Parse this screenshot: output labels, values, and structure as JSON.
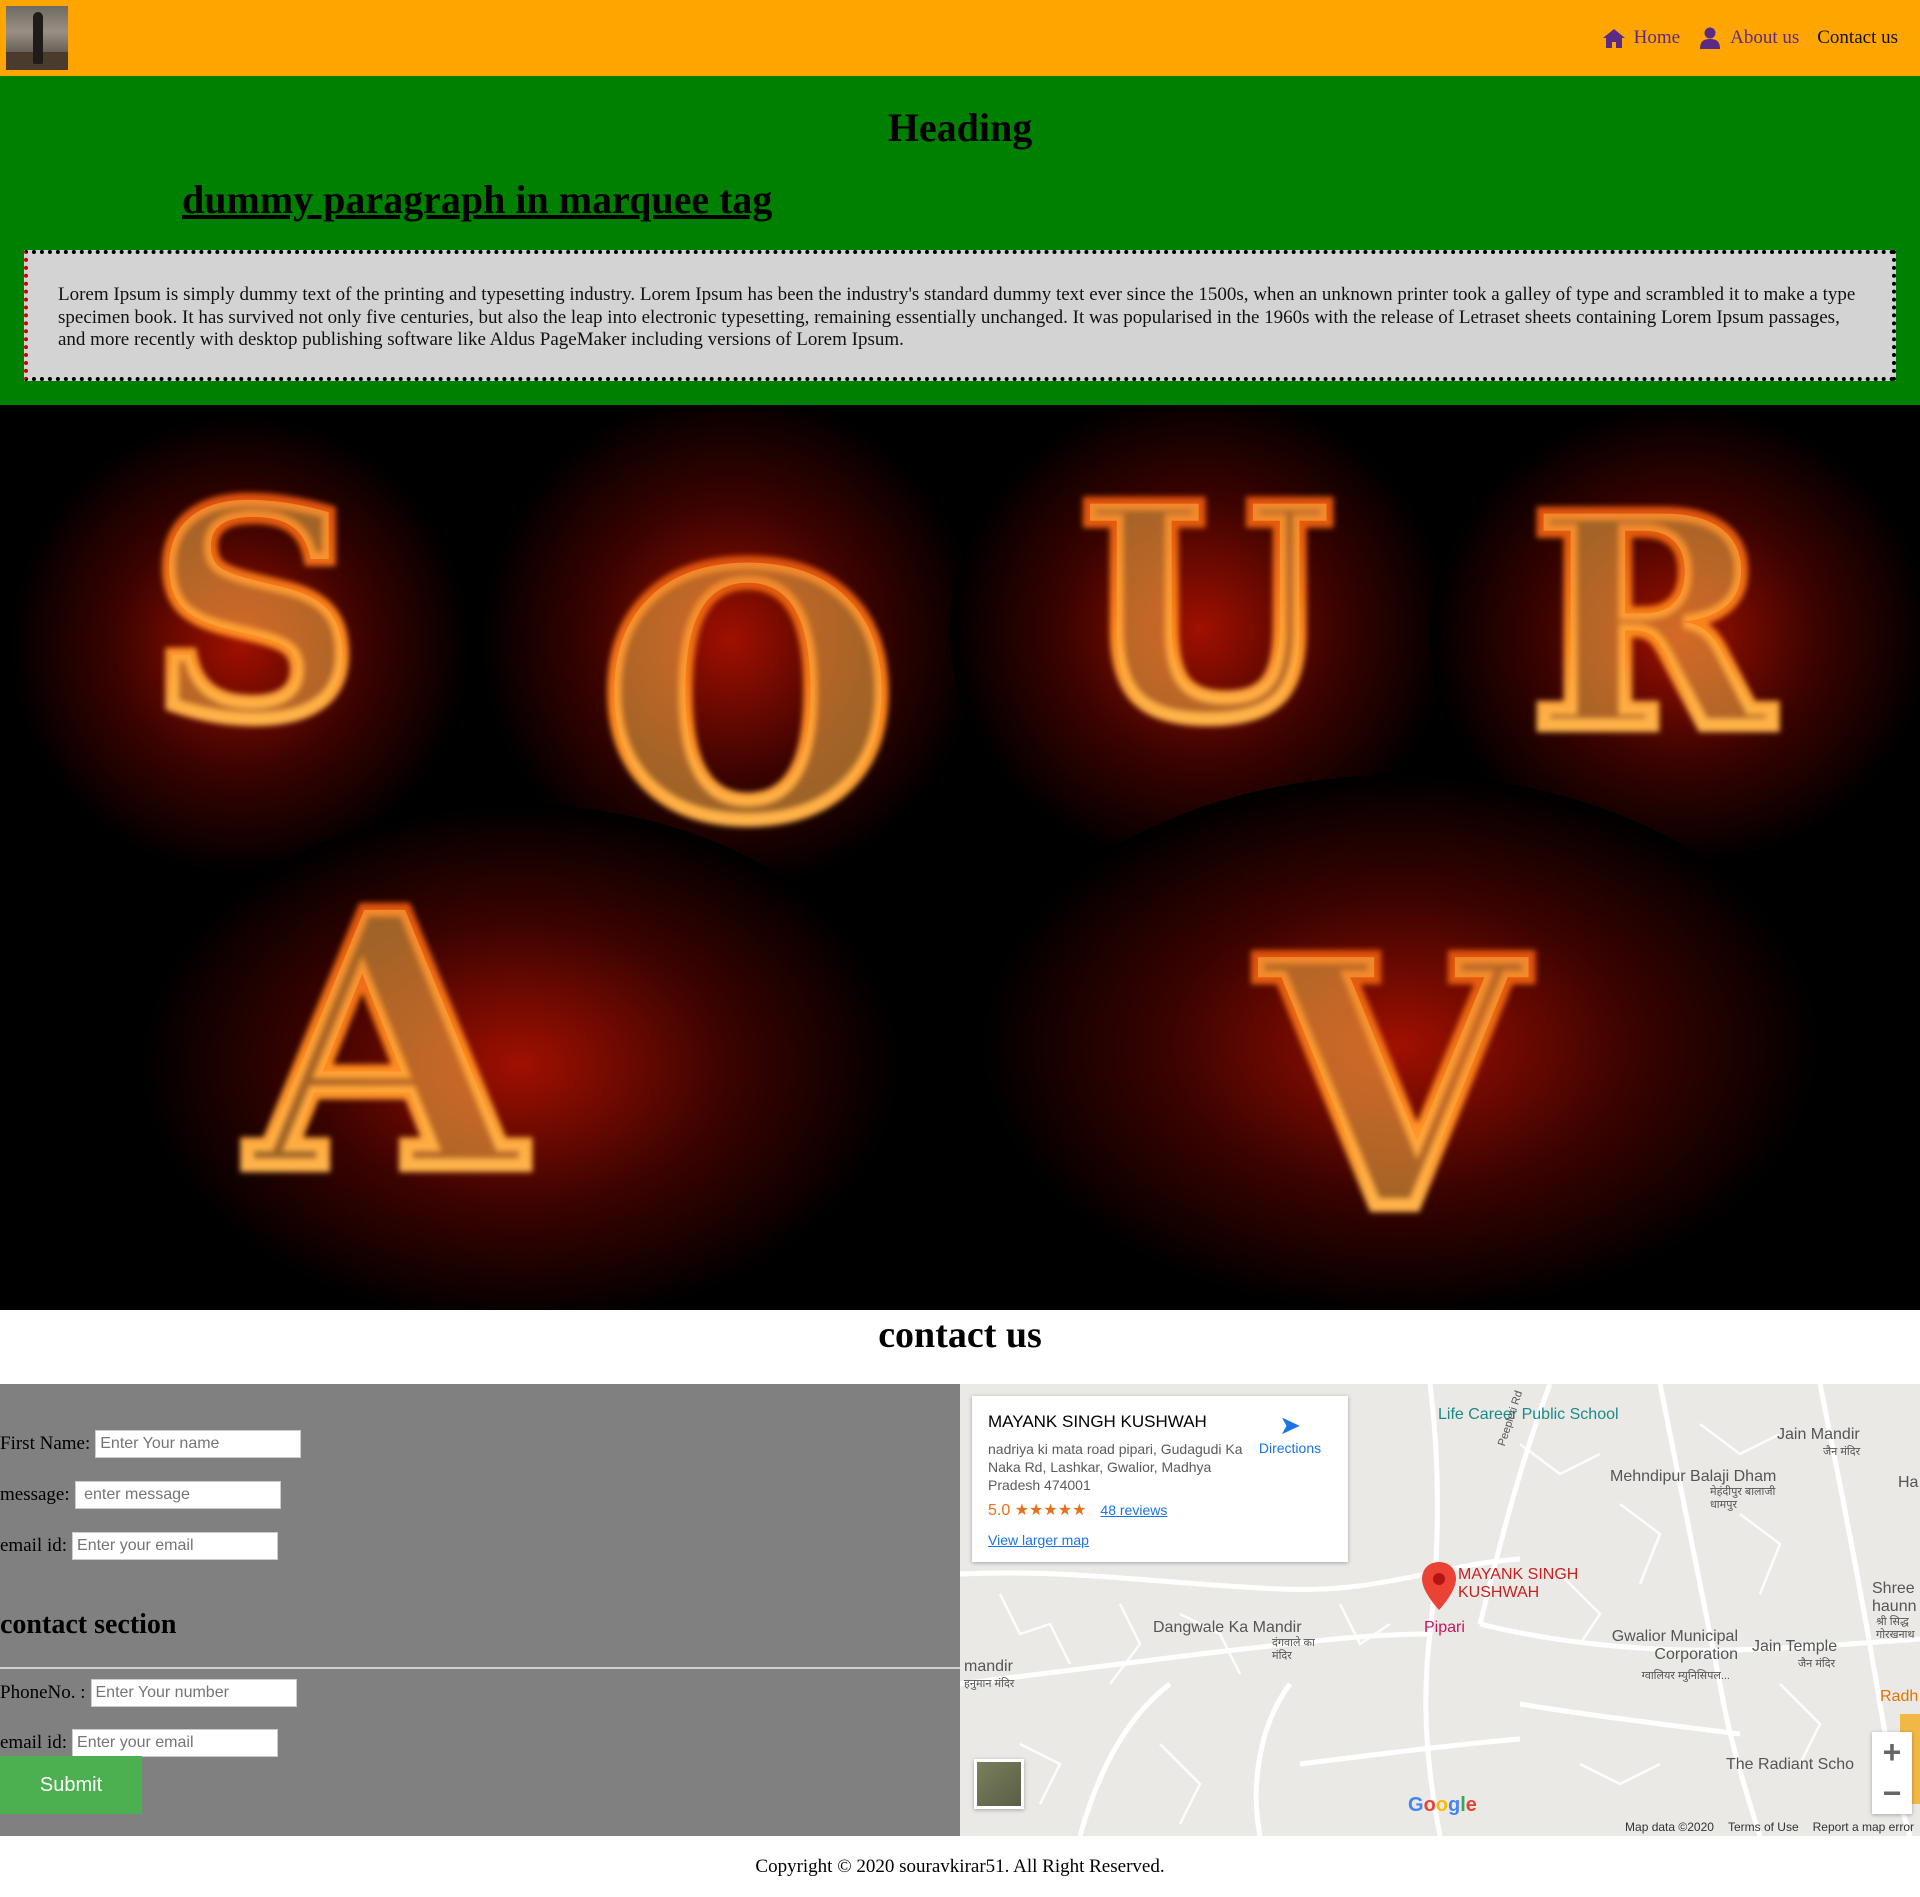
{
  "header": {
    "nav": [
      {
        "label": "Home",
        "icon": "home-icon"
      },
      {
        "label": "About us",
        "icon": "user-icon"
      },
      {
        "label": "Contact us"
      }
    ]
  },
  "hero": {
    "heading": "Heading",
    "marquee_text": "dummy paragraph in marquee tag",
    "lorem": "Lorem Ipsum is simply dummy text of the printing and typesetting industry. Lorem Ipsum has been the industry's standard dummy text ever since the 1500s, when an unknown printer took a galley of type and scrambled it to make a type specimen book. It has survived not only five centuries, but also the leap into electronic typesetting, remaining essentially unchanged. It was popularised in the 1960s with the release of Letraset sheets containing Lorem Ipsum passages, and more recently with desktop publishing software like Aldus PageMaker including versions of Lorem Ipsum."
  },
  "fire_letters": [
    "S",
    "O",
    "U",
    "R",
    "A",
    "V"
  ],
  "contact": {
    "title": "contact us",
    "first_name_label": "First Name:",
    "first_name_placeholder": "Enter Your name",
    "message_label": "message:",
    "message_placeholder": " enter message",
    "email_label": "email id:",
    "email_placeholder": "Enter your email",
    "section_title": "contact section",
    "phone_label": "PhoneNo. :",
    "phone_placeholder": "Enter Your number",
    "email2_label": "email id:",
    "email2_placeholder": "Enter your email",
    "submit_label": "Submit"
  },
  "map": {
    "place_name": "MAYANK SINGH KUSHWAH",
    "address": "nadriya ki mata road pipari, Gudagudi Ka Naka Rd, Lashkar, Gwalior, Madhya Pradesh 474001",
    "rating": "5.0",
    "stars": "★★★★★",
    "reviews": "48 reviews",
    "view_larger": "View larger map",
    "directions": "Directions",
    "labels": {
      "life_career": "Life Career Public School",
      "jain_mandir": "Jain Mandir",
      "jain_mandir_hi": "जैन मंदिर",
      "mehndipur": "Mehndipur Balaji Dham",
      "mehndipur_hi": "मेहंदीपुर बालाजी धामपुर",
      "ha": "Ha",
      "peepleri": "Peepleri Rd",
      "pin_label": "MAYANK SINGH KUSHWAH",
      "pipari": "Pipari",
      "dangwale": "Dangwale Ka Mandir",
      "dangwale_hi": "दंगवाले का मंदिर",
      "gwalior_mc": "Gwalior Municipal Corporation",
      "gwalior_mc_hi": "ग्वालियर म्युनिसिपल...",
      "jain_temple": "Jain Temple",
      "jain_temple_hi": "जैन मंदिर",
      "shree": "Shree haunn",
      "shree_hi": "श्री सिद्ध गोरखनाथ",
      "mandir": "mandir",
      "hanuman_hi": "हनुमान मंदिर",
      "radh": "Radh",
      "radiant": "The Radiant Scho"
    },
    "google": "Google",
    "attribution": [
      "Map data ©2020",
      "Terms of Use",
      "Report a map error"
    ]
  },
  "footer": {
    "copyright": "Copyright © 2020 souravkirar51. All Right Reserved."
  }
}
